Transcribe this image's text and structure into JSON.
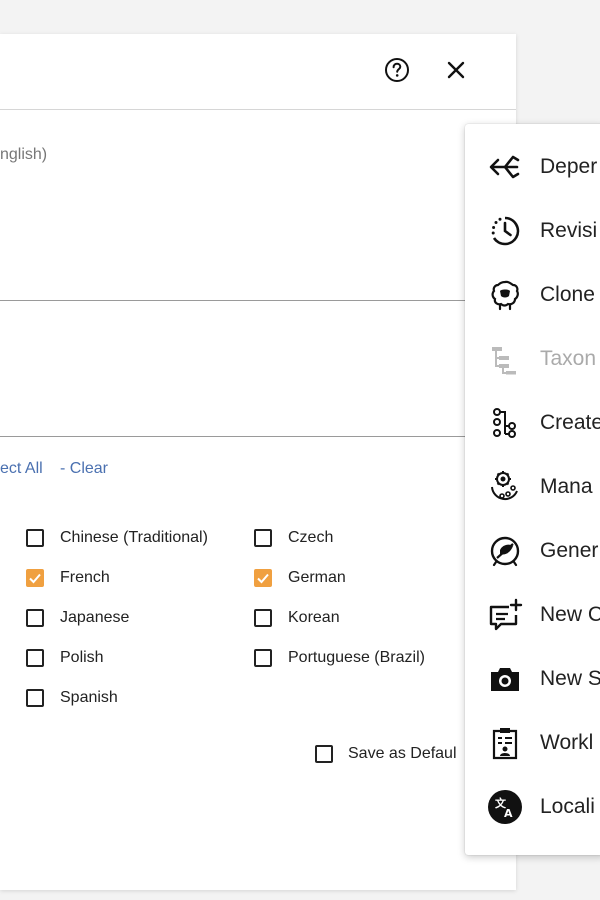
{
  "dialog": {
    "description_fragment": "nglish)",
    "select_all_link": "ect All",
    "clear_link": "-  Clear",
    "languages": [
      {
        "label": "Chinese (Traditional)",
        "checked": false
      },
      {
        "label": "Czech",
        "checked": false
      },
      {
        "label": "French",
        "checked": true
      },
      {
        "label": "German",
        "checked": true
      },
      {
        "label": "Japanese",
        "checked": false
      },
      {
        "label": "Korean",
        "checked": false
      },
      {
        "label": "Polish",
        "checked": false
      },
      {
        "label": "Portuguese (Brazil)",
        "checked": false
      },
      {
        "label": "Spanish",
        "checked": false
      }
    ],
    "save_default_label": "Save as Defaul",
    "save_default_checked": false,
    "checkbox_checked_color": "#f0a040"
  },
  "menu": {
    "items": [
      {
        "label": "Deper",
        "icon": "dependency-arrows-icon",
        "disabled": false
      },
      {
        "label": "Revisi",
        "icon": "revision-history-icon",
        "disabled": false
      },
      {
        "label": "Clone",
        "icon": "clone-sheep-icon",
        "disabled": false
      },
      {
        "label": "Taxon",
        "icon": "taxonomy-tree-icon",
        "disabled": true
      },
      {
        "label": "Create",
        "icon": "create-flow-icon",
        "disabled": false
      },
      {
        "label": "Mana",
        "icon": "manage-gear-icon",
        "disabled": false
      },
      {
        "label": "Gener",
        "icon": "generate-icon",
        "disabled": false
      },
      {
        "label": "New C",
        "icon": "new-comment-icon",
        "disabled": false
      },
      {
        "label": "New S",
        "icon": "camera-icon",
        "disabled": false
      },
      {
        "label": "Workl",
        "icon": "worklist-icon",
        "disabled": false
      },
      {
        "label": "Locali",
        "icon": "translate-icon",
        "disabled": false
      }
    ]
  }
}
